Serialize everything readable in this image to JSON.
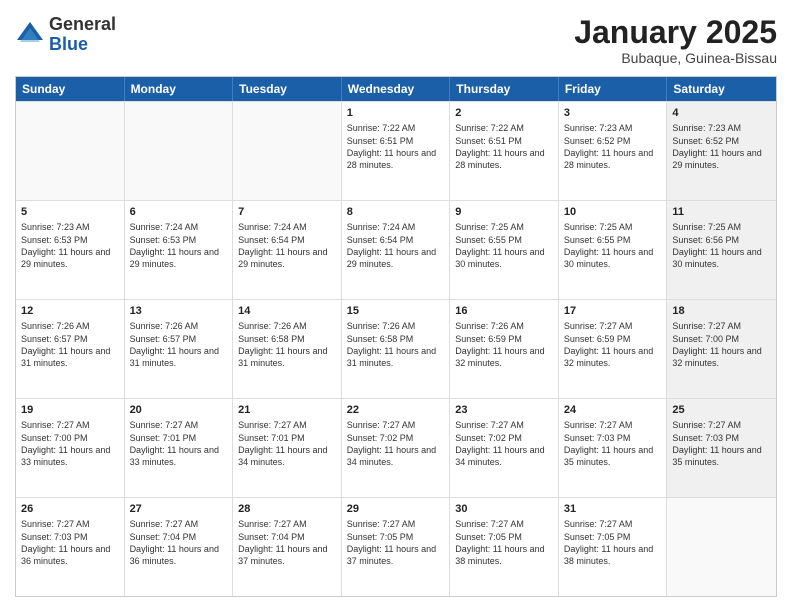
{
  "logo": {
    "general": "General",
    "blue": "Blue"
  },
  "header": {
    "month": "January 2025",
    "location": "Bubaque, Guinea-Bissau"
  },
  "weekdays": [
    "Sunday",
    "Monday",
    "Tuesday",
    "Wednesday",
    "Thursday",
    "Friday",
    "Saturday"
  ],
  "rows": [
    [
      {
        "day": "",
        "sunrise": "",
        "sunset": "",
        "daylight": "",
        "shaded": false,
        "empty": true
      },
      {
        "day": "",
        "sunrise": "",
        "sunset": "",
        "daylight": "",
        "shaded": false,
        "empty": true
      },
      {
        "day": "",
        "sunrise": "",
        "sunset": "",
        "daylight": "",
        "shaded": false,
        "empty": true
      },
      {
        "day": "1",
        "sunrise": "Sunrise: 7:22 AM",
        "sunset": "Sunset: 6:51 PM",
        "daylight": "Daylight: 11 hours and 28 minutes.",
        "shaded": false,
        "empty": false
      },
      {
        "day": "2",
        "sunrise": "Sunrise: 7:22 AM",
        "sunset": "Sunset: 6:51 PM",
        "daylight": "Daylight: 11 hours and 28 minutes.",
        "shaded": false,
        "empty": false
      },
      {
        "day": "3",
        "sunrise": "Sunrise: 7:23 AM",
        "sunset": "Sunset: 6:52 PM",
        "daylight": "Daylight: 11 hours and 28 minutes.",
        "shaded": false,
        "empty": false
      },
      {
        "day": "4",
        "sunrise": "Sunrise: 7:23 AM",
        "sunset": "Sunset: 6:52 PM",
        "daylight": "Daylight: 11 hours and 29 minutes.",
        "shaded": true,
        "empty": false
      }
    ],
    [
      {
        "day": "5",
        "sunrise": "Sunrise: 7:23 AM",
        "sunset": "Sunset: 6:53 PM",
        "daylight": "Daylight: 11 hours and 29 minutes.",
        "shaded": false,
        "empty": false
      },
      {
        "day": "6",
        "sunrise": "Sunrise: 7:24 AM",
        "sunset": "Sunset: 6:53 PM",
        "daylight": "Daylight: 11 hours and 29 minutes.",
        "shaded": false,
        "empty": false
      },
      {
        "day": "7",
        "sunrise": "Sunrise: 7:24 AM",
        "sunset": "Sunset: 6:54 PM",
        "daylight": "Daylight: 11 hours and 29 minutes.",
        "shaded": false,
        "empty": false
      },
      {
        "day": "8",
        "sunrise": "Sunrise: 7:24 AM",
        "sunset": "Sunset: 6:54 PM",
        "daylight": "Daylight: 11 hours and 29 minutes.",
        "shaded": false,
        "empty": false
      },
      {
        "day": "9",
        "sunrise": "Sunrise: 7:25 AM",
        "sunset": "Sunset: 6:55 PM",
        "daylight": "Daylight: 11 hours and 30 minutes.",
        "shaded": false,
        "empty": false
      },
      {
        "day": "10",
        "sunrise": "Sunrise: 7:25 AM",
        "sunset": "Sunset: 6:55 PM",
        "daylight": "Daylight: 11 hours and 30 minutes.",
        "shaded": false,
        "empty": false
      },
      {
        "day": "11",
        "sunrise": "Sunrise: 7:25 AM",
        "sunset": "Sunset: 6:56 PM",
        "daylight": "Daylight: 11 hours and 30 minutes.",
        "shaded": true,
        "empty": false
      }
    ],
    [
      {
        "day": "12",
        "sunrise": "Sunrise: 7:26 AM",
        "sunset": "Sunset: 6:57 PM",
        "daylight": "Daylight: 11 hours and 31 minutes.",
        "shaded": false,
        "empty": false
      },
      {
        "day": "13",
        "sunrise": "Sunrise: 7:26 AM",
        "sunset": "Sunset: 6:57 PM",
        "daylight": "Daylight: 11 hours and 31 minutes.",
        "shaded": false,
        "empty": false
      },
      {
        "day": "14",
        "sunrise": "Sunrise: 7:26 AM",
        "sunset": "Sunset: 6:58 PM",
        "daylight": "Daylight: 11 hours and 31 minutes.",
        "shaded": false,
        "empty": false
      },
      {
        "day": "15",
        "sunrise": "Sunrise: 7:26 AM",
        "sunset": "Sunset: 6:58 PM",
        "daylight": "Daylight: 11 hours and 31 minutes.",
        "shaded": false,
        "empty": false
      },
      {
        "day": "16",
        "sunrise": "Sunrise: 7:26 AM",
        "sunset": "Sunset: 6:59 PM",
        "daylight": "Daylight: 11 hours and 32 minutes.",
        "shaded": false,
        "empty": false
      },
      {
        "day": "17",
        "sunrise": "Sunrise: 7:27 AM",
        "sunset": "Sunset: 6:59 PM",
        "daylight": "Daylight: 11 hours and 32 minutes.",
        "shaded": false,
        "empty": false
      },
      {
        "day": "18",
        "sunrise": "Sunrise: 7:27 AM",
        "sunset": "Sunset: 7:00 PM",
        "daylight": "Daylight: 11 hours and 32 minutes.",
        "shaded": true,
        "empty": false
      }
    ],
    [
      {
        "day": "19",
        "sunrise": "Sunrise: 7:27 AM",
        "sunset": "Sunset: 7:00 PM",
        "daylight": "Daylight: 11 hours and 33 minutes.",
        "shaded": false,
        "empty": false
      },
      {
        "day": "20",
        "sunrise": "Sunrise: 7:27 AM",
        "sunset": "Sunset: 7:01 PM",
        "daylight": "Daylight: 11 hours and 33 minutes.",
        "shaded": false,
        "empty": false
      },
      {
        "day": "21",
        "sunrise": "Sunrise: 7:27 AM",
        "sunset": "Sunset: 7:01 PM",
        "daylight": "Daylight: 11 hours and 34 minutes.",
        "shaded": false,
        "empty": false
      },
      {
        "day": "22",
        "sunrise": "Sunrise: 7:27 AM",
        "sunset": "Sunset: 7:02 PM",
        "daylight": "Daylight: 11 hours and 34 minutes.",
        "shaded": false,
        "empty": false
      },
      {
        "day": "23",
        "sunrise": "Sunrise: 7:27 AM",
        "sunset": "Sunset: 7:02 PM",
        "daylight": "Daylight: 11 hours and 34 minutes.",
        "shaded": false,
        "empty": false
      },
      {
        "day": "24",
        "sunrise": "Sunrise: 7:27 AM",
        "sunset": "Sunset: 7:03 PM",
        "daylight": "Daylight: 11 hours and 35 minutes.",
        "shaded": false,
        "empty": false
      },
      {
        "day": "25",
        "sunrise": "Sunrise: 7:27 AM",
        "sunset": "Sunset: 7:03 PM",
        "daylight": "Daylight: 11 hours and 35 minutes.",
        "shaded": true,
        "empty": false
      }
    ],
    [
      {
        "day": "26",
        "sunrise": "Sunrise: 7:27 AM",
        "sunset": "Sunset: 7:03 PM",
        "daylight": "Daylight: 11 hours and 36 minutes.",
        "shaded": false,
        "empty": false
      },
      {
        "day": "27",
        "sunrise": "Sunrise: 7:27 AM",
        "sunset": "Sunset: 7:04 PM",
        "daylight": "Daylight: 11 hours and 36 minutes.",
        "shaded": false,
        "empty": false
      },
      {
        "day": "28",
        "sunrise": "Sunrise: 7:27 AM",
        "sunset": "Sunset: 7:04 PM",
        "daylight": "Daylight: 11 hours and 37 minutes.",
        "shaded": false,
        "empty": false
      },
      {
        "day": "29",
        "sunrise": "Sunrise: 7:27 AM",
        "sunset": "Sunset: 7:05 PM",
        "daylight": "Daylight: 11 hours and 37 minutes.",
        "shaded": false,
        "empty": false
      },
      {
        "day": "30",
        "sunrise": "Sunrise: 7:27 AM",
        "sunset": "Sunset: 7:05 PM",
        "daylight": "Daylight: 11 hours and 38 minutes.",
        "shaded": false,
        "empty": false
      },
      {
        "day": "31",
        "sunrise": "Sunrise: 7:27 AM",
        "sunset": "Sunset: 7:05 PM",
        "daylight": "Daylight: 11 hours and 38 minutes.",
        "shaded": false,
        "empty": false
      },
      {
        "day": "",
        "sunrise": "",
        "sunset": "",
        "daylight": "",
        "shaded": true,
        "empty": true
      }
    ]
  ]
}
